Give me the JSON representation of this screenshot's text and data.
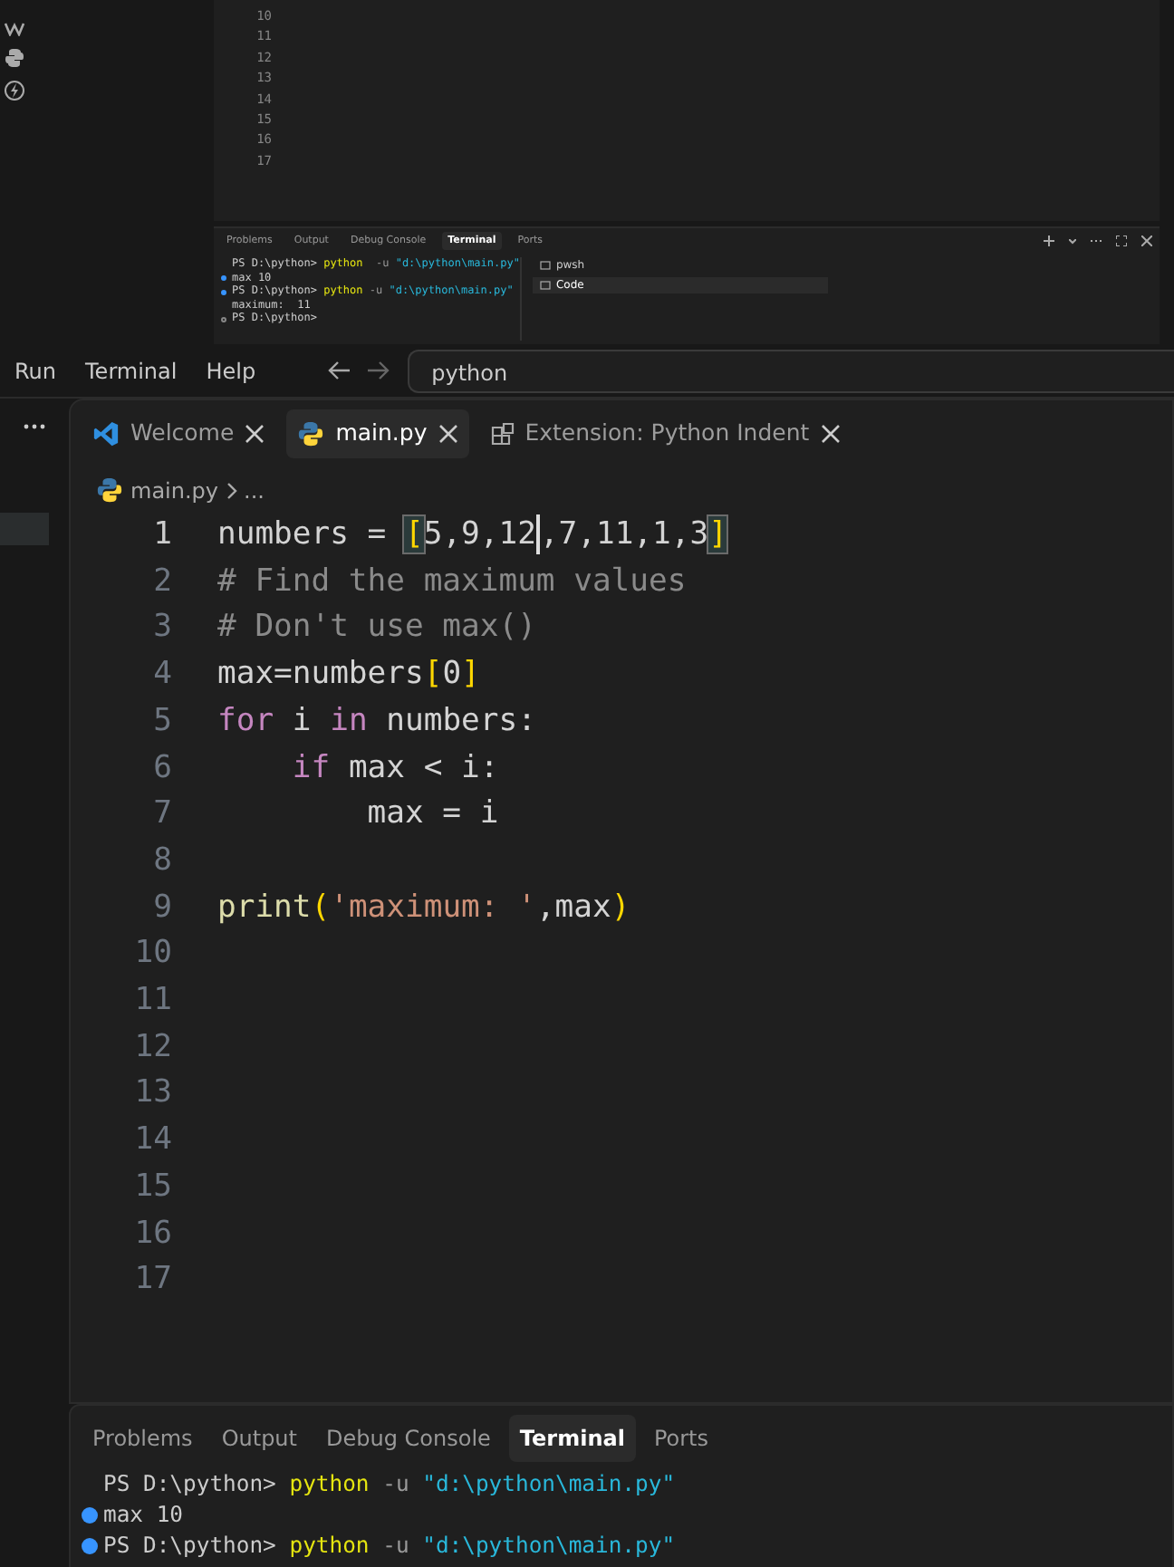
{
  "preview": {
    "line_numbers": [
      "10",
      "11",
      "12",
      "13",
      "14",
      "15",
      "16",
      "17"
    ],
    "panel_tabs": [
      {
        "label": "Problems",
        "selected": false
      },
      {
        "label": "Output",
        "selected": false
      },
      {
        "label": "Debug Console",
        "selected": false
      },
      {
        "label": "Terminal",
        "selected": true
      },
      {
        "label": "Ports",
        "selected": false
      }
    ],
    "terminal": [
      {
        "kind": "plain",
        "segments": [
          {
            "text": "PS D:\\python> ",
            "kind": "plain"
          },
          {
            "text": "python",
            "kind": "command"
          },
          {
            "text": "  -u ",
            "kind": "flag"
          },
          {
            "text": "\"d:\\python\\main.py\"",
            "kind": "string"
          }
        ]
      },
      {
        "kind": "success",
        "segments": [
          {
            "text": "max 10",
            "kind": "plain"
          }
        ]
      },
      {
        "kind": "success",
        "segments": [
          {
            "text": "PS D:\\python> ",
            "kind": "plain"
          },
          {
            "text": "python",
            "kind": "command"
          },
          {
            "text": " -u ",
            "kind": "flag"
          },
          {
            "text": "\"d:\\python\\main.py\"",
            "kind": "string"
          }
        ]
      },
      {
        "kind": "plain",
        "segments": [
          {
            "text": "maximum:  11",
            "kind": "plain"
          }
        ]
      },
      {
        "kind": "pending",
        "segments": [
          {
            "text": "PS D:\\python> ",
            "kind": "plain"
          }
        ]
      }
    ],
    "terminal_list": [
      {
        "label": "pwsh",
        "selected": false
      },
      {
        "label": "Code",
        "selected": true
      }
    ]
  },
  "menu": [
    "Run",
    "Terminal",
    "Help"
  ],
  "command_center": {
    "value": "python"
  },
  "tabs": [
    {
      "label": "Welcome",
      "kind": "welcome",
      "selected": false
    },
    {
      "label": "main.py",
      "kind": "python",
      "selected": true
    },
    {
      "label": "Extension: Python Indent",
      "kind": "extension",
      "selected": false
    }
  ],
  "breadcrumb": {
    "file": "main.py",
    "rest": "..."
  },
  "code": [
    {
      "number": "1",
      "tokens": [
        {
          "text": "numbers = ",
          "kind": "plain"
        },
        {
          "text": "[",
          "kind": "bracket_match"
        },
        {
          "text": "5,9,12",
          "kind": "plain"
        },
        {
          "kind": "cursor"
        },
        {
          "text": ",7,11,1,3",
          "kind": "plain"
        },
        {
          "text": "]",
          "kind": "bracket_match"
        }
      ]
    },
    {
      "number": "2",
      "tokens": [
        {
          "text": "# Find the maximum values",
          "kind": "comment"
        }
      ]
    },
    {
      "number": "3",
      "tokens": [
        {
          "text": "# Don't use max()",
          "kind": "comment"
        }
      ]
    },
    {
      "number": "4",
      "tokens": [
        {
          "text": "max=numbers",
          "kind": "plain"
        },
        {
          "text": "[",
          "kind": "bracket"
        },
        {
          "text": "0",
          "kind": "plain"
        },
        {
          "text": "]",
          "kind": "bracket"
        }
      ]
    },
    {
      "number": "5",
      "tokens": [
        {
          "text": "for",
          "kind": "keyword"
        },
        {
          "text": " i ",
          "kind": "plain"
        },
        {
          "text": "in",
          "kind": "keyword"
        },
        {
          "text": " numbers:",
          "kind": "plain"
        }
      ]
    },
    {
      "number": "6",
      "tokens": [
        {
          "text": "    if",
          "kind": "keyword"
        },
        {
          "text": " max < i:",
          "kind": "plain"
        }
      ]
    },
    {
      "number": "7",
      "tokens": [
        {
          "text": "        max = i",
          "kind": "plain"
        }
      ]
    },
    {
      "number": "8"
    },
    {
      "number": "9",
      "tokens": [
        {
          "text": "print",
          "kind": "function"
        },
        {
          "text": "(",
          "kind": "bracket"
        },
        {
          "text": "'maximum: '",
          "kind": "string"
        },
        {
          "text": ",max",
          "kind": "plain"
        },
        {
          "text": ")",
          "kind": "bracket"
        }
      ]
    },
    {
      "number": "10"
    },
    {
      "number": "11"
    },
    {
      "number": "12"
    },
    {
      "number": "13"
    },
    {
      "number": "14"
    },
    {
      "number": "15"
    },
    {
      "number": "16"
    },
    {
      "number": "17"
    }
  ],
  "panel_tabs": [
    {
      "label": "Problems",
      "selected": false
    },
    {
      "label": "Output",
      "selected": false
    },
    {
      "label": "Debug Console",
      "selected": false
    },
    {
      "label": "Terminal",
      "selected": true
    },
    {
      "label": "Ports",
      "selected": false
    }
  ],
  "terminal": [
    {
      "kind": "plain",
      "segments": [
        {
          "text": "PS D:\\python> ",
          "kind": "plain"
        },
        {
          "text": "python",
          "kind": "command"
        },
        {
          "text": " -u ",
          "kind": "flag"
        },
        {
          "text": "\"d:\\python\\main.py\"",
          "kind": "string"
        }
      ]
    },
    {
      "kind": "success",
      "segments": [
        {
          "text": "max 10",
          "kind": "plain"
        }
      ]
    },
    {
      "kind": "success",
      "segments": [
        {
          "text": "PS D:\\python> ",
          "kind": "plain"
        },
        {
          "text": "python",
          "kind": "command"
        },
        {
          "text": " -u ",
          "kind": "flag"
        },
        {
          "text": "\"d:\\python\\main.py\"",
          "kind": "string"
        }
      ]
    }
  ]
}
